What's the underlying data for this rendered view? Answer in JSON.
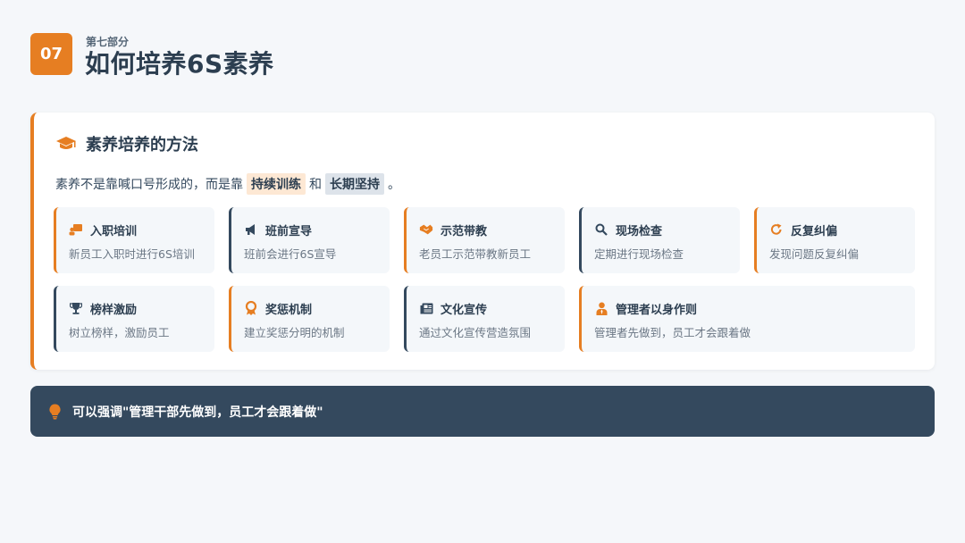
{
  "header": {
    "number": "07",
    "section_label": "第七部分",
    "title": "如何培养6S素养"
  },
  "card": {
    "title": "素养培养的方法",
    "icon": "graduation-cap-icon",
    "intro_before": "素养不是靠喊口号形成的，而是靠",
    "highlight1": "持续训练",
    "intro_mid": "和",
    "highlight2": "长期坚持",
    "intro_after": "。",
    "items": [
      {
        "title": "入职培训",
        "desc": "新员工入职时进行6S培训",
        "icon": "teacher-icon"
      },
      {
        "title": "班前宣导",
        "desc": "班前会进行6S宣导",
        "icon": "megaphone-icon"
      },
      {
        "title": "示范带教",
        "desc": "老员工示范带教新员工",
        "icon": "handshake-icon"
      },
      {
        "title": "现场检查",
        "desc": "定期进行现场检查",
        "icon": "search-icon"
      },
      {
        "title": "反复纠偏",
        "desc": "发现问题反复纠偏",
        "icon": "redo-icon"
      },
      {
        "title": "榜样激励",
        "desc": "树立榜样，激励员工",
        "icon": "trophy-icon"
      },
      {
        "title": "奖惩机制",
        "desc": "建立奖惩分明的机制",
        "icon": "award-icon"
      },
      {
        "title": "文化宣传",
        "desc": "通过文化宣传营造氛围",
        "icon": "newspaper-icon"
      },
      {
        "title": "管理者以身作则",
        "desc": "管理者先做到，员工才会跟着做",
        "icon": "user-tie-icon"
      }
    ]
  },
  "banner": {
    "text": "可以强调\"管理干部先做到，员工才会跟着做\"",
    "icon": "lightbulb-icon"
  },
  "colors": {
    "accent": "#e67e22",
    "dark": "#34495e",
    "background": "#f5f7fa"
  }
}
